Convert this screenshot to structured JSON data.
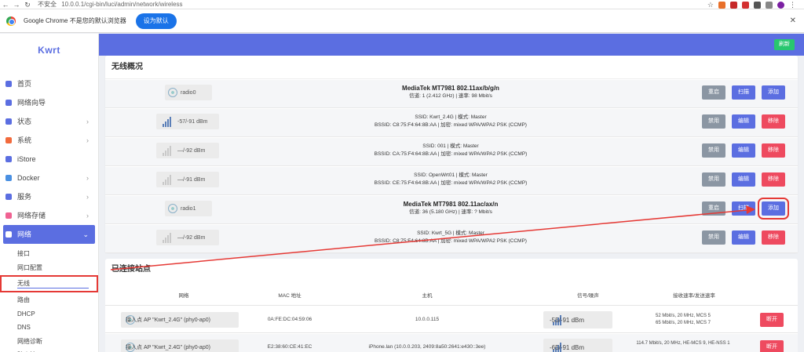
{
  "browser": {
    "url_warning": "不安全",
    "url": "10.0.0.1/cgi-bin/luci/admin/network/wireless",
    "infobar_text": "Google Chrome 不是您的默认浏览器",
    "infobar_button": "设为默认"
  },
  "sidebar": {
    "logo": "Kwrt",
    "items": [
      {
        "label": "首页",
        "color": "#5b6ee1",
        "chevron": false
      },
      {
        "label": "网络向导",
        "color": "#5b6ee1",
        "chevron": false
      },
      {
        "label": "状态",
        "color": "#5b6ee1",
        "chevron": true
      },
      {
        "label": "系统",
        "color": "#f26a3c",
        "chevron": true
      },
      {
        "label": "iStore",
        "color": "#5b6ee1",
        "chevron": false
      },
      {
        "label": "Docker",
        "color": "#4a90e2",
        "chevron": true
      },
      {
        "label": "服务",
        "color": "#5b6ee1",
        "chevron": true
      },
      {
        "label": "网络存储",
        "color": "#f06292",
        "chevron": true
      },
      {
        "label": "网络",
        "color": "#ffffff",
        "chevron": true
      }
    ],
    "submenu": [
      "接口",
      "网口配置",
      "无线",
      "路由",
      "DHCP",
      "DNS",
      "网络诊断",
      "防火墙"
    ]
  },
  "header": {
    "refresh": "刷新"
  },
  "wireless": {
    "title": "无线概况",
    "rows": [
      {
        "kind": "radio",
        "badge": "radio0",
        "model": "MediaTek MT7981 802.11ax/b/g/n",
        "detail": "信道: 1 (2.412 GHz) | 速率: 98 Mbit/s",
        "buttons": [
          "重启",
          "扫描",
          "添加"
        ]
      },
      {
        "kind": "net",
        "signal": "-57/-91 dBm",
        "good": true,
        "ssid": "SSID: Kwrt_2.4G | 模式: Master",
        "bssid": "BSSID: C8:75:F4:64:8B:AA | 加密: mixed WPA/WPA2 PSK (CCMP)",
        "buttons": [
          "禁用",
          "编辑",
          "移除"
        ]
      },
      {
        "kind": "net",
        "signal": "—/-92 dBm",
        "good": false,
        "ssid": "SSID: 001 | 模式: Master",
        "bssid": "BSSID: CA:75:F4:64:8B:AA | 加密: mixed WPA/WPA2 PSK (CCMP)",
        "buttons": [
          "禁用",
          "编辑",
          "移除"
        ]
      },
      {
        "kind": "net",
        "signal": "—/-91 dBm",
        "good": false,
        "ssid": "SSID: OpenWrt01 | 模式: Master",
        "bssid": "BSSID: CE:75:F4:64:8B:AA | 加密: mixed WPA/WPA2 PSK (CCMP)",
        "buttons": [
          "禁用",
          "编辑",
          "移除"
        ]
      },
      {
        "kind": "radio",
        "badge": "radio1",
        "model": "MediaTek MT7981 802.11ac/ax/n",
        "detail": "信道: 36 (5.180 GHz) | 速率: ? Mbit/s",
        "buttons": [
          "重启",
          "扫描",
          "添加"
        ]
      },
      {
        "kind": "net",
        "signal": "—/-92 dBm",
        "good": false,
        "ssid": "SSID: Kwrt_5G | 模式: Master",
        "bssid": "BSSID: C8:75:F4:64:8B:AA | 加密: mixed WPA/WPA2 PSK (CCMP)",
        "buttons": [
          "禁用",
          "编辑",
          "移除"
        ]
      }
    ]
  },
  "stations": {
    "title": "已连接站点",
    "headers": [
      "网络",
      "MAC 地址",
      "主机",
      "信号/噪声",
      "接收速率/发送速率"
    ],
    "rows": [
      {
        "network": "接入点 AP \"Kwrt_2.4G\" (phy0-ap0)",
        "mac": "0A:FE:DC:04:59:06",
        "host": "10.0.0.115",
        "signal": "-55/-91 dBm",
        "rate1": "52 Mbit/s, 20 MHz, MCS 5",
        "rate2": "65 Mbit/s, 20 MHz, MCS 7",
        "action": "断开"
      },
      {
        "network": "接入点 AP \"Kwrt_2.4G\" (phy0-ap0)",
        "mac": "E2:38:60:CE:41:EC",
        "host": "iPhone.lan (10.0.0.203, 2409:8a50:2641:e430::3ee)",
        "signal": "-65/-91 dBm",
        "rate1": "114.7 Mbit/s, 20 MHz, HE-MCS 9, HE-NSS 1",
        "rate2": "",
        "action": "断开"
      }
    ]
  }
}
